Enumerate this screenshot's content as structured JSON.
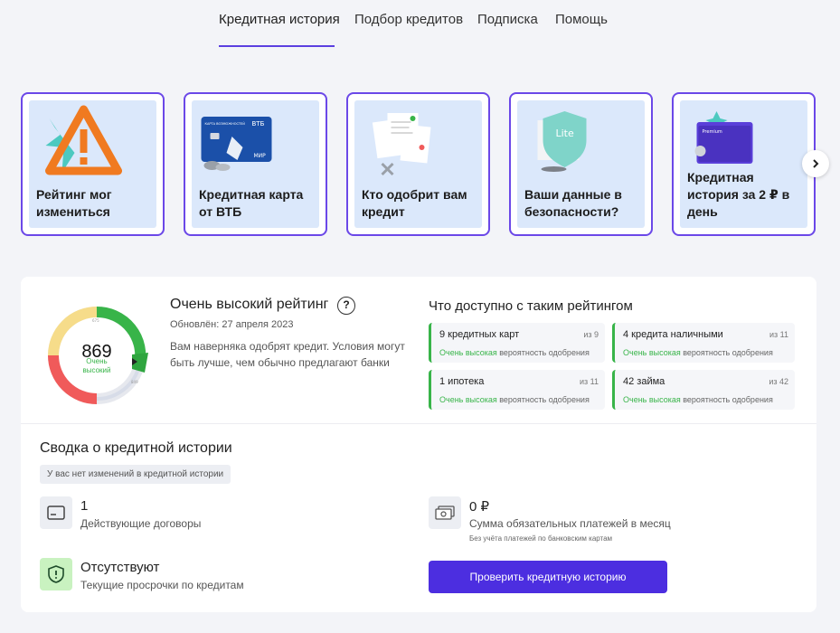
{
  "nav": {
    "tabs": [
      {
        "label": "Кредитная история",
        "active": true
      },
      {
        "label": "Подбор кредитов",
        "active": false
      },
      {
        "label": "Подписка",
        "active": false
      },
      {
        "label": "Помощь",
        "active": false
      }
    ]
  },
  "promos": [
    {
      "title": "Рейтинг мог изменить­ся",
      "icon": "warning-icon"
    },
    {
      "title": "Кредитная карта от ВТБ",
      "icon": "bank-card-icon"
    },
    {
      "title": "Кто одобрит вам кредит",
      "icon": "documents-icon"
    },
    {
      "title": "Ваши данные в безопасности?",
      "icon": "shield-lite-icon"
    },
    {
      "title": "Кредитная история за 2 ₽ в день",
      "icon": "folder-icon"
    }
  ],
  "promo_art": {
    "card_bank": "ВТБ",
    "card_caption": "КАРТА ВОЗМОЖНОСТЕЙ",
    "card_network": "МИР",
    "shield_text": "Lite",
    "folder_text": "Premium"
  },
  "score": {
    "value": "869",
    "label": "Очень высокий",
    "title": "Очень высокий рейтинг",
    "help": "?",
    "updated": "Обновлён: 27 апреля 2023",
    "description": "Вам наверняка одобрят кредит. Условия могут быть лучше, чем обычно предлагают банки",
    "gauge_marks": {
      "top": "675",
      "right": "849"
    },
    "gauge_level": 0.869
  },
  "availability": {
    "title": "Что доступно с таким рейтингом",
    "offers": [
      {
        "name": "9 кредитных карт",
        "of": "из 9",
        "prob_hi": "Очень высокая",
        "prob_rest": " вероятность одобрения"
      },
      {
        "name": "4 кредита наличными",
        "of": "из 11",
        "prob_hi": "Очень высокая",
        "prob_rest": " вероятность одобрения"
      },
      {
        "name": "1 ипотека",
        "of": "из 11",
        "prob_hi": "Очень высокая",
        "prob_rest": " вероятность одобрения"
      },
      {
        "name": "42 займа",
        "of": "из 42",
        "prob_hi": "Очень высокая",
        "prob_rest": " вероятность одобрения"
      }
    ]
  },
  "summary": {
    "title": "Сводка о кредитной истории",
    "no_changes": "У вас нет изменений в кредитной истории",
    "contracts": {
      "value": "1",
      "label": "Действующие договоры"
    },
    "payments": {
      "value": "0 ₽",
      "label": "Сумма обязательных платежей в месяц",
      "note": "Без учёта платежей по банковским картам"
    },
    "overdue": {
      "value": "Отсутствуют",
      "label": "Текущие просрочки по кредитам"
    },
    "cta": "Проверить кредитную историю"
  },
  "colors": {
    "accent": "#5b3fe0",
    "success": "#38b449",
    "danger": "#f05a5a",
    "warning": "#f6dc8a",
    "card_bg": "#dbe8fb"
  }
}
